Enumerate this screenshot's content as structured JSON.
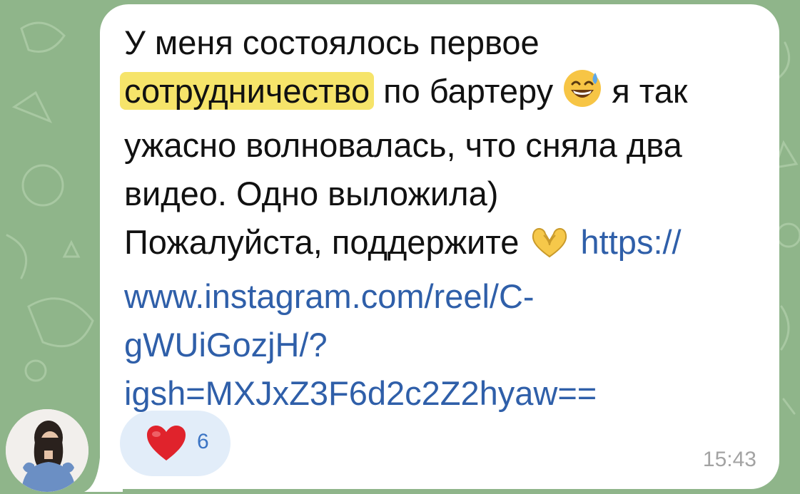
{
  "colors": {
    "chat_background": "#8fb58a",
    "bubble": "#ffffff",
    "highlight": "#f6e46a",
    "link": "#2f5fa9",
    "reaction_pill": "#e2edf9",
    "reaction_count": "#3b74c4",
    "timestamp": "#a3a3a3"
  },
  "message": {
    "line1": "У меня состоялось первое",
    "highlighted_word": "сотрудничество",
    "line2_after": " по бартеру ",
    "emoji_grin_sweat": "grinning-face-with-sweat-icon",
    "line2_tail": " я так",
    "line3": "ужасно волновалась, что сняла два",
    "line4": "видео. Одно выложила)",
    "line5": "Пожалуйста, поддержите ",
    "emoji_heart_hands": "heart-hands-icon",
    "link_part1": "https://",
    "link_part2": "www.instagram.com/reel/C-",
    "link_part3": "gWUiGozjH/?",
    "link_part4": "igsh=MXJxZ3F6d2c2Z2hyaw=="
  },
  "reaction": {
    "emoji": "red-heart-icon",
    "count": "6"
  },
  "timestamp": "15:43",
  "sender": {
    "avatar": "avatar"
  }
}
